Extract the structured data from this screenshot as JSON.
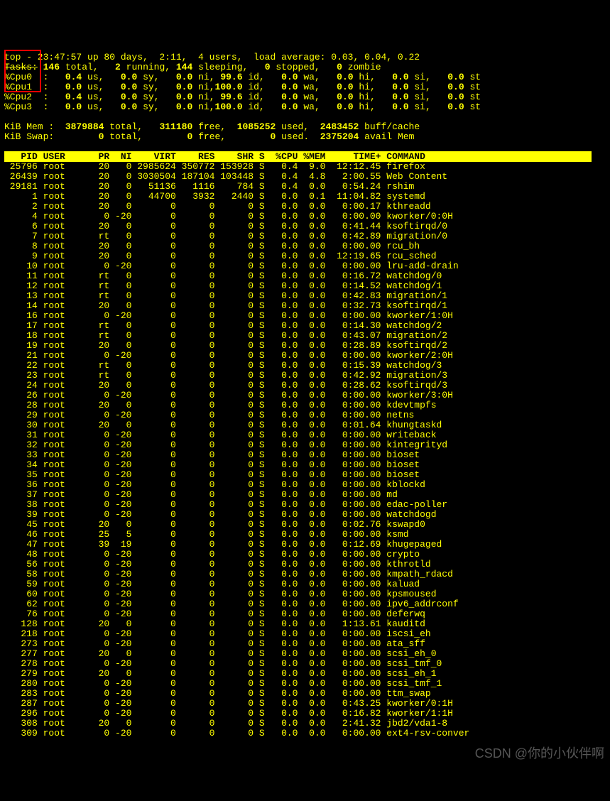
{
  "uptime": "top - 23:47:57 up 80 days,  2:11,  4 users,  load average: 0.03, 0.04, 0.22",
  "tasks": {
    "label": "Tasks:",
    "total": "146",
    "running": "2",
    "sleeping": "144",
    "stopped": "0",
    "zombie": "0"
  },
  "cpus": [
    {
      "name": "%Cpu0",
      "us": "0.4",
      "sy": "0.0",
      "ni": "0.0",
      "id": "99.6",
      "wa": "0.0",
      "hi": "0.0",
      "si": "0.0",
      "st": "0.0"
    },
    {
      "name": "%Cpu1",
      "us": "0.0",
      "sy": "0.0",
      "ni": "0.0",
      "id": "100.0",
      "wa": "0.0",
      "hi": "0.0",
      "si": "0.0",
      "st": "0.0"
    },
    {
      "name": "%Cpu2",
      "us": "0.4",
      "sy": "0.0",
      "ni": "0.0",
      "id": "99.6",
      "wa": "0.0",
      "hi": "0.0",
      "si": "0.0",
      "st": "0.0"
    },
    {
      "name": "%Cpu3",
      "us": "0.0",
      "sy": "0.0",
      "ni": "0.0",
      "id": "100.0",
      "wa": "0.0",
      "hi": "0.0",
      "si": "0.0",
      "st": "0.0"
    }
  ],
  "mem": {
    "label": "KiB Mem :",
    "total": "3879884",
    "free": "311180",
    "used": "1085252",
    "buff": "2483452"
  },
  "swap": {
    "label": "KiB Swap:",
    "total": "0",
    "free": "0",
    "used": "0",
    "avail": "2375204"
  },
  "cols": {
    "pid": "PID",
    "user": "USER",
    "pr": "PR",
    "ni": "NI",
    "virt": "VIRT",
    "res": "RES",
    "shr": "SHR",
    "s": "S",
    "cpu": "%CPU",
    "mem": "%MEM",
    "time": "TIME+",
    "cmd": "COMMAND"
  },
  "procs": [
    {
      "pid": "25796",
      "user": "root",
      "pr": "20",
      "ni": "0",
      "virt": "2985624",
      "res": "350772",
      "shr": "153928",
      "s": "S",
      "cpu": "0.4",
      "mem": "9.0",
      "time": "12:12.45",
      "cmd": "firefox"
    },
    {
      "pid": "26439",
      "user": "root",
      "pr": "20",
      "ni": "0",
      "virt": "3030504",
      "res": "187104",
      "shr": "103448",
      "s": "S",
      "cpu": "0.4",
      "mem": "4.8",
      "time": "2:00.55",
      "cmd": "Web Content"
    },
    {
      "pid": "29181",
      "user": "root",
      "pr": "20",
      "ni": "0",
      "virt": "51136",
      "res": "1116",
      "shr": "784",
      "s": "S",
      "cpu": "0.4",
      "mem": "0.0",
      "time": "0:54.24",
      "cmd": "rshim"
    },
    {
      "pid": "1",
      "user": "root",
      "pr": "20",
      "ni": "0",
      "virt": "44700",
      "res": "3932",
      "shr": "2440",
      "s": "S",
      "cpu": "0.0",
      "mem": "0.1",
      "time": "11:04.82",
      "cmd": "systemd"
    },
    {
      "pid": "2",
      "user": "root",
      "pr": "20",
      "ni": "0",
      "virt": "0",
      "res": "0",
      "shr": "0",
      "s": "S",
      "cpu": "0.0",
      "mem": "0.0",
      "time": "0:00.17",
      "cmd": "kthreadd"
    },
    {
      "pid": "4",
      "user": "root",
      "pr": "0",
      "ni": "-20",
      "virt": "0",
      "res": "0",
      "shr": "0",
      "s": "S",
      "cpu": "0.0",
      "mem": "0.0",
      "time": "0:00.00",
      "cmd": "kworker/0:0H"
    },
    {
      "pid": "6",
      "user": "root",
      "pr": "20",
      "ni": "0",
      "virt": "0",
      "res": "0",
      "shr": "0",
      "s": "S",
      "cpu": "0.0",
      "mem": "0.0",
      "time": "0:41.44",
      "cmd": "ksoftirqd/0"
    },
    {
      "pid": "7",
      "user": "root",
      "pr": "rt",
      "ni": "0",
      "virt": "0",
      "res": "0",
      "shr": "0",
      "s": "S",
      "cpu": "0.0",
      "mem": "0.0",
      "time": "0:42.89",
      "cmd": "migration/0"
    },
    {
      "pid": "8",
      "user": "root",
      "pr": "20",
      "ni": "0",
      "virt": "0",
      "res": "0",
      "shr": "0",
      "s": "S",
      "cpu": "0.0",
      "mem": "0.0",
      "time": "0:00.00",
      "cmd": "rcu_bh"
    },
    {
      "pid": "9",
      "user": "root",
      "pr": "20",
      "ni": "0",
      "virt": "0",
      "res": "0",
      "shr": "0",
      "s": "S",
      "cpu": "0.0",
      "mem": "0.0",
      "time": "12:19.65",
      "cmd": "rcu_sched"
    },
    {
      "pid": "10",
      "user": "root",
      "pr": "0",
      "ni": "-20",
      "virt": "0",
      "res": "0",
      "shr": "0",
      "s": "S",
      "cpu": "0.0",
      "mem": "0.0",
      "time": "0:00.00",
      "cmd": "lru-add-drain"
    },
    {
      "pid": "11",
      "user": "root",
      "pr": "rt",
      "ni": "0",
      "virt": "0",
      "res": "0",
      "shr": "0",
      "s": "S",
      "cpu": "0.0",
      "mem": "0.0",
      "time": "0:16.72",
      "cmd": "watchdog/0"
    },
    {
      "pid": "12",
      "user": "root",
      "pr": "rt",
      "ni": "0",
      "virt": "0",
      "res": "0",
      "shr": "0",
      "s": "S",
      "cpu": "0.0",
      "mem": "0.0",
      "time": "0:14.52",
      "cmd": "watchdog/1"
    },
    {
      "pid": "13",
      "user": "root",
      "pr": "rt",
      "ni": "0",
      "virt": "0",
      "res": "0",
      "shr": "0",
      "s": "S",
      "cpu": "0.0",
      "mem": "0.0",
      "time": "0:42.83",
      "cmd": "migration/1"
    },
    {
      "pid": "14",
      "user": "root",
      "pr": "20",
      "ni": "0",
      "virt": "0",
      "res": "0",
      "shr": "0",
      "s": "S",
      "cpu": "0.0",
      "mem": "0.0",
      "time": "0:32.73",
      "cmd": "ksoftirqd/1"
    },
    {
      "pid": "16",
      "user": "root",
      "pr": "0",
      "ni": "-20",
      "virt": "0",
      "res": "0",
      "shr": "0",
      "s": "S",
      "cpu": "0.0",
      "mem": "0.0",
      "time": "0:00.00",
      "cmd": "kworker/1:0H"
    },
    {
      "pid": "17",
      "user": "root",
      "pr": "rt",
      "ni": "0",
      "virt": "0",
      "res": "0",
      "shr": "0",
      "s": "S",
      "cpu": "0.0",
      "mem": "0.0",
      "time": "0:14.30",
      "cmd": "watchdog/2"
    },
    {
      "pid": "18",
      "user": "root",
      "pr": "rt",
      "ni": "0",
      "virt": "0",
      "res": "0",
      "shr": "0",
      "s": "S",
      "cpu": "0.0",
      "mem": "0.0",
      "time": "0:43.07",
      "cmd": "migration/2"
    },
    {
      "pid": "19",
      "user": "root",
      "pr": "20",
      "ni": "0",
      "virt": "0",
      "res": "0",
      "shr": "0",
      "s": "S",
      "cpu": "0.0",
      "mem": "0.0",
      "time": "0:28.89",
      "cmd": "ksoftirqd/2"
    },
    {
      "pid": "21",
      "user": "root",
      "pr": "0",
      "ni": "-20",
      "virt": "0",
      "res": "0",
      "shr": "0",
      "s": "S",
      "cpu": "0.0",
      "mem": "0.0",
      "time": "0:00.00",
      "cmd": "kworker/2:0H"
    },
    {
      "pid": "22",
      "user": "root",
      "pr": "rt",
      "ni": "0",
      "virt": "0",
      "res": "0",
      "shr": "0",
      "s": "S",
      "cpu": "0.0",
      "mem": "0.0",
      "time": "0:15.39",
      "cmd": "watchdog/3"
    },
    {
      "pid": "23",
      "user": "root",
      "pr": "rt",
      "ni": "0",
      "virt": "0",
      "res": "0",
      "shr": "0",
      "s": "S",
      "cpu": "0.0",
      "mem": "0.0",
      "time": "0:42.92",
      "cmd": "migration/3"
    },
    {
      "pid": "24",
      "user": "root",
      "pr": "20",
      "ni": "0",
      "virt": "0",
      "res": "0",
      "shr": "0",
      "s": "S",
      "cpu": "0.0",
      "mem": "0.0",
      "time": "0:28.62",
      "cmd": "ksoftirqd/3"
    },
    {
      "pid": "26",
      "user": "root",
      "pr": "0",
      "ni": "-20",
      "virt": "0",
      "res": "0",
      "shr": "0",
      "s": "S",
      "cpu": "0.0",
      "mem": "0.0",
      "time": "0:00.00",
      "cmd": "kworker/3:0H"
    },
    {
      "pid": "28",
      "user": "root",
      "pr": "20",
      "ni": "0",
      "virt": "0",
      "res": "0",
      "shr": "0",
      "s": "S",
      "cpu": "0.0",
      "mem": "0.0",
      "time": "0:00.00",
      "cmd": "kdevtmpfs"
    },
    {
      "pid": "29",
      "user": "root",
      "pr": "0",
      "ni": "-20",
      "virt": "0",
      "res": "0",
      "shr": "0",
      "s": "S",
      "cpu": "0.0",
      "mem": "0.0",
      "time": "0:00.00",
      "cmd": "netns"
    },
    {
      "pid": "30",
      "user": "root",
      "pr": "20",
      "ni": "0",
      "virt": "0",
      "res": "0",
      "shr": "0",
      "s": "S",
      "cpu": "0.0",
      "mem": "0.0",
      "time": "0:01.64",
      "cmd": "khungtaskd"
    },
    {
      "pid": "31",
      "user": "root",
      "pr": "0",
      "ni": "-20",
      "virt": "0",
      "res": "0",
      "shr": "0",
      "s": "S",
      "cpu": "0.0",
      "mem": "0.0",
      "time": "0:00.00",
      "cmd": "writeback"
    },
    {
      "pid": "32",
      "user": "root",
      "pr": "0",
      "ni": "-20",
      "virt": "0",
      "res": "0",
      "shr": "0",
      "s": "S",
      "cpu": "0.0",
      "mem": "0.0",
      "time": "0:00.00",
      "cmd": "kintegrityd"
    },
    {
      "pid": "33",
      "user": "root",
      "pr": "0",
      "ni": "-20",
      "virt": "0",
      "res": "0",
      "shr": "0",
      "s": "S",
      "cpu": "0.0",
      "mem": "0.0",
      "time": "0:00.00",
      "cmd": "bioset"
    },
    {
      "pid": "34",
      "user": "root",
      "pr": "0",
      "ni": "-20",
      "virt": "0",
      "res": "0",
      "shr": "0",
      "s": "S",
      "cpu": "0.0",
      "mem": "0.0",
      "time": "0:00.00",
      "cmd": "bioset"
    },
    {
      "pid": "35",
      "user": "root",
      "pr": "0",
      "ni": "-20",
      "virt": "0",
      "res": "0",
      "shr": "0",
      "s": "S",
      "cpu": "0.0",
      "mem": "0.0",
      "time": "0:00.00",
      "cmd": "bioset"
    },
    {
      "pid": "36",
      "user": "root",
      "pr": "0",
      "ni": "-20",
      "virt": "0",
      "res": "0",
      "shr": "0",
      "s": "S",
      "cpu": "0.0",
      "mem": "0.0",
      "time": "0:00.00",
      "cmd": "kblockd"
    },
    {
      "pid": "37",
      "user": "root",
      "pr": "0",
      "ni": "-20",
      "virt": "0",
      "res": "0",
      "shr": "0",
      "s": "S",
      "cpu": "0.0",
      "mem": "0.0",
      "time": "0:00.00",
      "cmd": "md"
    },
    {
      "pid": "38",
      "user": "root",
      "pr": "0",
      "ni": "-20",
      "virt": "0",
      "res": "0",
      "shr": "0",
      "s": "S",
      "cpu": "0.0",
      "mem": "0.0",
      "time": "0:00.00",
      "cmd": "edac-poller"
    },
    {
      "pid": "39",
      "user": "root",
      "pr": "0",
      "ni": "-20",
      "virt": "0",
      "res": "0",
      "shr": "0",
      "s": "S",
      "cpu": "0.0",
      "mem": "0.0",
      "time": "0:00.00",
      "cmd": "watchdogd"
    },
    {
      "pid": "45",
      "user": "root",
      "pr": "20",
      "ni": "0",
      "virt": "0",
      "res": "0",
      "shr": "0",
      "s": "S",
      "cpu": "0.0",
      "mem": "0.0",
      "time": "0:02.76",
      "cmd": "kswapd0"
    },
    {
      "pid": "46",
      "user": "root",
      "pr": "25",
      "ni": "5",
      "virt": "0",
      "res": "0",
      "shr": "0",
      "s": "S",
      "cpu": "0.0",
      "mem": "0.0",
      "time": "0:00.00",
      "cmd": "ksmd"
    },
    {
      "pid": "47",
      "user": "root",
      "pr": "39",
      "ni": "19",
      "virt": "0",
      "res": "0",
      "shr": "0",
      "s": "S",
      "cpu": "0.0",
      "mem": "0.0",
      "time": "0:12.69",
      "cmd": "khugepaged"
    },
    {
      "pid": "48",
      "user": "root",
      "pr": "0",
      "ni": "-20",
      "virt": "0",
      "res": "0",
      "shr": "0",
      "s": "S",
      "cpu": "0.0",
      "mem": "0.0",
      "time": "0:00.00",
      "cmd": "crypto"
    },
    {
      "pid": "56",
      "user": "root",
      "pr": "0",
      "ni": "-20",
      "virt": "0",
      "res": "0",
      "shr": "0",
      "s": "S",
      "cpu": "0.0",
      "mem": "0.0",
      "time": "0:00.00",
      "cmd": "kthrotld"
    },
    {
      "pid": "58",
      "user": "root",
      "pr": "0",
      "ni": "-20",
      "virt": "0",
      "res": "0",
      "shr": "0",
      "s": "S",
      "cpu": "0.0",
      "mem": "0.0",
      "time": "0:00.00",
      "cmd": "kmpath_rdacd"
    },
    {
      "pid": "59",
      "user": "root",
      "pr": "0",
      "ni": "-20",
      "virt": "0",
      "res": "0",
      "shr": "0",
      "s": "S",
      "cpu": "0.0",
      "mem": "0.0",
      "time": "0:00.00",
      "cmd": "kaluad"
    },
    {
      "pid": "60",
      "user": "root",
      "pr": "0",
      "ni": "-20",
      "virt": "0",
      "res": "0",
      "shr": "0",
      "s": "S",
      "cpu": "0.0",
      "mem": "0.0",
      "time": "0:00.00",
      "cmd": "kpsmoused"
    },
    {
      "pid": "62",
      "user": "root",
      "pr": "0",
      "ni": "-20",
      "virt": "0",
      "res": "0",
      "shr": "0",
      "s": "S",
      "cpu": "0.0",
      "mem": "0.0",
      "time": "0:00.00",
      "cmd": "ipv6_addrconf"
    },
    {
      "pid": "76",
      "user": "root",
      "pr": "0",
      "ni": "-20",
      "virt": "0",
      "res": "0",
      "shr": "0",
      "s": "S",
      "cpu": "0.0",
      "mem": "0.0",
      "time": "0:00.00",
      "cmd": "deferwq"
    },
    {
      "pid": "128",
      "user": "root",
      "pr": "20",
      "ni": "0",
      "virt": "0",
      "res": "0",
      "shr": "0",
      "s": "S",
      "cpu": "0.0",
      "mem": "0.0",
      "time": "1:13.61",
      "cmd": "kauditd"
    },
    {
      "pid": "218",
      "user": "root",
      "pr": "0",
      "ni": "-20",
      "virt": "0",
      "res": "0",
      "shr": "0",
      "s": "S",
      "cpu": "0.0",
      "mem": "0.0",
      "time": "0:00.00",
      "cmd": "iscsi_eh"
    },
    {
      "pid": "273",
      "user": "root",
      "pr": "0",
      "ni": "-20",
      "virt": "0",
      "res": "0",
      "shr": "0",
      "s": "S",
      "cpu": "0.0",
      "mem": "0.0",
      "time": "0:00.00",
      "cmd": "ata_sff"
    },
    {
      "pid": "277",
      "user": "root",
      "pr": "20",
      "ni": "0",
      "virt": "0",
      "res": "0",
      "shr": "0",
      "s": "S",
      "cpu": "0.0",
      "mem": "0.0",
      "time": "0:00.00",
      "cmd": "scsi_eh_0"
    },
    {
      "pid": "278",
      "user": "root",
      "pr": "0",
      "ni": "-20",
      "virt": "0",
      "res": "0",
      "shr": "0",
      "s": "S",
      "cpu": "0.0",
      "mem": "0.0",
      "time": "0:00.00",
      "cmd": "scsi_tmf_0"
    },
    {
      "pid": "279",
      "user": "root",
      "pr": "20",
      "ni": "0",
      "virt": "0",
      "res": "0",
      "shr": "0",
      "s": "S",
      "cpu": "0.0",
      "mem": "0.0",
      "time": "0:00.00",
      "cmd": "scsi_eh_1"
    },
    {
      "pid": "280",
      "user": "root",
      "pr": "0",
      "ni": "-20",
      "virt": "0",
      "res": "0",
      "shr": "0",
      "s": "S",
      "cpu": "0.0",
      "mem": "0.0",
      "time": "0:00.00",
      "cmd": "scsi_tmf_1"
    },
    {
      "pid": "283",
      "user": "root",
      "pr": "0",
      "ni": "-20",
      "virt": "0",
      "res": "0",
      "shr": "0",
      "s": "S",
      "cpu": "0.0",
      "mem": "0.0",
      "time": "0:00.00",
      "cmd": "ttm_swap"
    },
    {
      "pid": "287",
      "user": "root",
      "pr": "0",
      "ni": "-20",
      "virt": "0",
      "res": "0",
      "shr": "0",
      "s": "S",
      "cpu": "0.0",
      "mem": "0.0",
      "time": "0:43.25",
      "cmd": "kworker/0:1H"
    },
    {
      "pid": "296",
      "user": "root",
      "pr": "0",
      "ni": "-20",
      "virt": "0",
      "res": "0",
      "shr": "0",
      "s": "S",
      "cpu": "0.0",
      "mem": "0.0",
      "time": "0:16.82",
      "cmd": "kworker/1:1H"
    },
    {
      "pid": "308",
      "user": "root",
      "pr": "20",
      "ni": "0",
      "virt": "0",
      "res": "0",
      "shr": "0",
      "s": "S",
      "cpu": "0.0",
      "mem": "0.0",
      "time": "2:41.32",
      "cmd": "jbd2/vda1-8"
    },
    {
      "pid": "309",
      "user": "root",
      "pr": "0",
      "ni": "-20",
      "virt": "0",
      "res": "0",
      "shr": "0",
      "s": "S",
      "cpu": "0.0",
      "mem": "0.0",
      "time": "0:00.00",
      "cmd": "ext4-rsv-conver"
    }
  ],
  "watermark": "CSDN @你的小伙伴啊"
}
